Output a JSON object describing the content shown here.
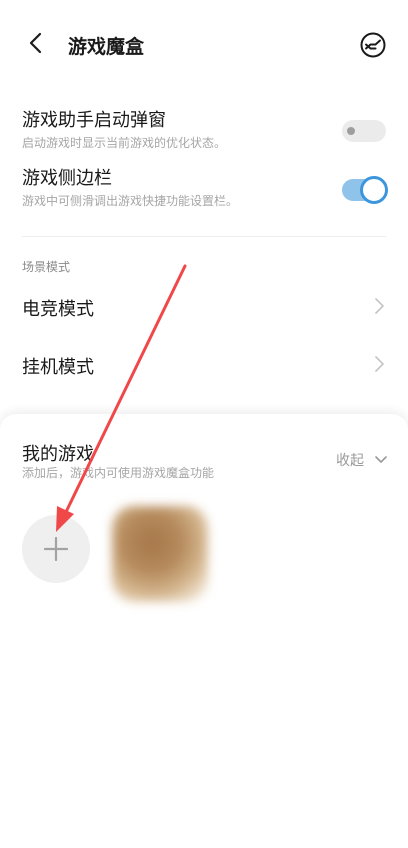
{
  "header": {
    "title": "游戏魔盒",
    "back_icon": "chevron-left-icon",
    "perf_icon": "performance-mode-icon"
  },
  "settings": {
    "popup": {
      "title": "游戏助手启动弹窗",
      "subtitle": "启动游戏时显示当前游戏的优化状态。",
      "enabled": false
    },
    "sidebar": {
      "title": "游戏侧边栏",
      "subtitle": "游戏中可侧滑调出游戏快捷功能设置栏。",
      "enabled": true
    }
  },
  "scene": {
    "section_label": "场景模式",
    "items": [
      {
        "label": "电竞模式"
      },
      {
        "label": "挂机模式"
      }
    ]
  },
  "my_games": {
    "title": "我的游戏",
    "subtitle": "添加后，游戏内可使用游戏魔盒功能",
    "collapse_label": "收起",
    "add_icon": "plus-icon"
  },
  "colors": {
    "accent": "#3d96dd",
    "annotation_arrow": "#f04848"
  }
}
